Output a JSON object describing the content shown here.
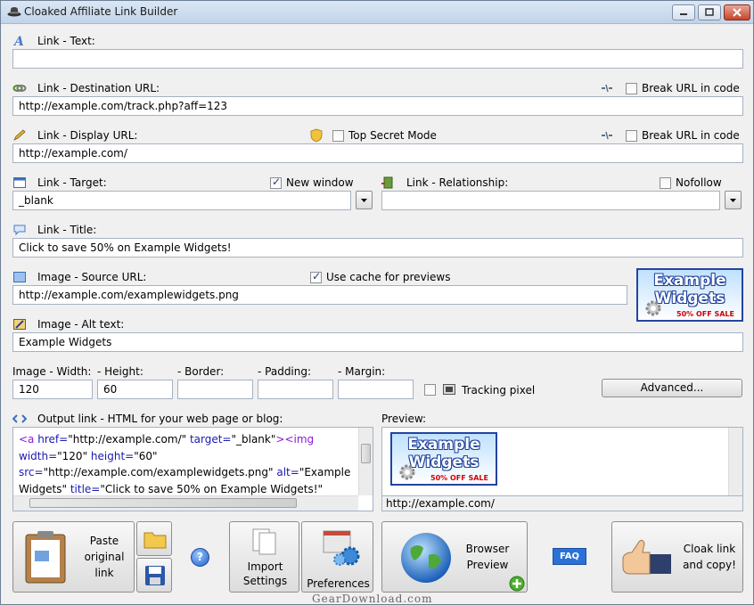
{
  "window": {
    "title": "Cloaked Affiliate Link Builder",
    "controls": {
      "minimize": "▬",
      "maximize": "□",
      "close": "✕"
    }
  },
  "link_text": {
    "label": "Link - Text:",
    "value": ""
  },
  "destination": {
    "label": "Link - Destination URL:",
    "value": "http://example.com/track.php?aff=123",
    "break_label": "Break URL in code",
    "break_checked": false
  },
  "display": {
    "label": "Link - Display URL:",
    "value": "http://example.com/",
    "top_secret_label": "Top Secret Mode",
    "top_secret_checked": false,
    "break_label": "Break URL in code",
    "break_checked": false
  },
  "target": {
    "label": "Link - Target:",
    "new_window_label": "New window",
    "new_window_checked": true,
    "value": "_blank"
  },
  "relationship": {
    "label": "Link - Relationship:",
    "nofollow_label": "Nofollow",
    "nofollow_checked": false,
    "value": ""
  },
  "title_field": {
    "label": "Link - Title:",
    "value": "Click to save 50% on Example Widgets!"
  },
  "image": {
    "label": "Image - Source URL:",
    "value": "http://example.com/examplewidgets.png",
    "cache_label": "Use cache for previews",
    "cache_checked": true
  },
  "promo_image": {
    "line1": "Example",
    "line2": "Widgets",
    "line3": "50% OFF SALE"
  },
  "alt": {
    "label": "Image - Alt text:",
    "value": "Example Widgets"
  },
  "dims": {
    "width_label": "Image - Width:",
    "width_value": "120",
    "height_label": "- Height:",
    "height_value": "60",
    "border_label": "- Border:",
    "border_value": "",
    "padding_label": "- Padding:",
    "padding_value": "",
    "margin_label": "- Margin:",
    "margin_value": "",
    "tracking_label": "Tracking pixel",
    "tracking_checked": false,
    "advanced_label": "Advanced..."
  },
  "output": {
    "label": "Output link - HTML for your web page or blog:",
    "line1_tag": "<a",
    "line1_attr1": " href=",
    "line1_val1": "\"http://example.com/\"",
    "line1_attr2": " target=",
    "line1_val2": "\"_blank\"",
    "line1_end": "><img",
    "line2_attr1": "width=",
    "line2_val1": "\"120\"",
    "line2_attr2": " height=",
    "line2_val2": "\"60\"",
    "line3_attr1": "src=",
    "line3_val1": "\"http://example.com/examplewidgets.png\"",
    "line3_attr2": " alt=",
    "line3_val2": "\"Example",
    "line4_val2": "Widgets\"",
    "line4_attr3": " title=",
    "line4_val3": "\"Click to save 50% on Example Widgets!\""
  },
  "preview": {
    "label": "Preview:",
    "url": "http://example.com/"
  },
  "buttons": {
    "paste": "Paste\noriginal\nlink",
    "import": "Import\nSettings",
    "preferences": "Preferences",
    "browser": "Browser\nPreview",
    "faq": "FAQ",
    "cloak": "Cloak link\nand copy!",
    "help": "?"
  },
  "watermark": "GearDownload.com",
  "colors": {
    "accent": "#2344a0",
    "tag_purple": "#8a1ad8",
    "string_blue": "#1a1ab0",
    "faq_blue": "#2a72d6"
  }
}
